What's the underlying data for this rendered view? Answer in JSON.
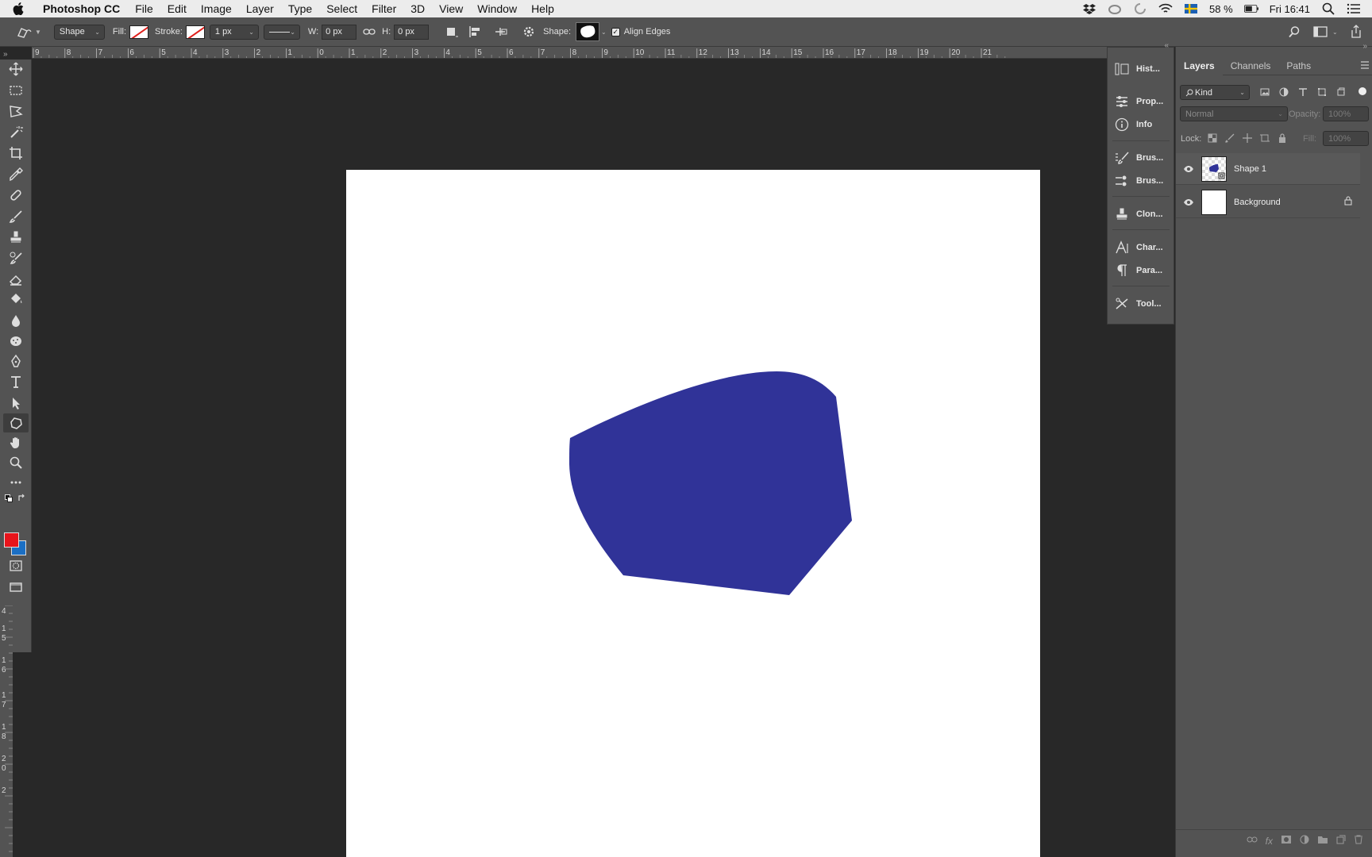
{
  "menubar": {
    "app_name": "Photoshop CC",
    "items": [
      "File",
      "Edit",
      "Image",
      "Layer",
      "Type",
      "Select",
      "Filter",
      "3D",
      "View",
      "Window",
      "Help"
    ],
    "battery": "58 %",
    "clock": "Fri 16:41"
  },
  "options": {
    "mode": "Shape",
    "fill_label": "Fill:",
    "stroke_label": "Stroke:",
    "stroke_width": "1 px",
    "w_label": "W:",
    "w_value": "0 px",
    "h_label": "H:",
    "h_value": "0 px",
    "shape_label": "Shape:",
    "align_edges": "Align Edges"
  },
  "ruler_top": [
    "9",
    "8",
    "7",
    "6",
    "5",
    "4",
    "3",
    "2",
    "1",
    "0",
    "1",
    "2",
    "3",
    "4",
    "5",
    "6",
    "7",
    "8",
    "9",
    "10",
    "11",
    "12",
    "13",
    "14",
    "15",
    "16",
    "17",
    "18",
    "19",
    "20",
    "21"
  ],
  "ruler_left": [
    "4",
    "1",
    "5",
    "1",
    "6",
    "1",
    "7",
    "1",
    "8",
    "2",
    "0",
    "2"
  ],
  "colors": {
    "foreground": "#e8141b",
    "background": "#1b6fc4",
    "shape_fill": "#303398"
  },
  "dock": {
    "items": [
      "Hist...",
      "Prop...",
      "Info",
      "Brus...",
      "Brus...",
      "Clon...",
      "Char...",
      "Para...",
      "Tool..."
    ]
  },
  "layers": {
    "tabs": [
      "Layers",
      "Channels",
      "Paths"
    ],
    "kind": "Kind",
    "blend_mode": "Normal",
    "opacity_label": "Opacity:",
    "opacity_value": "100%",
    "lock_label": "Lock:",
    "fill_label": "Fill:",
    "fill_value": "100%",
    "rows": [
      {
        "name": "Shape 1"
      },
      {
        "name": "Background"
      }
    ]
  }
}
